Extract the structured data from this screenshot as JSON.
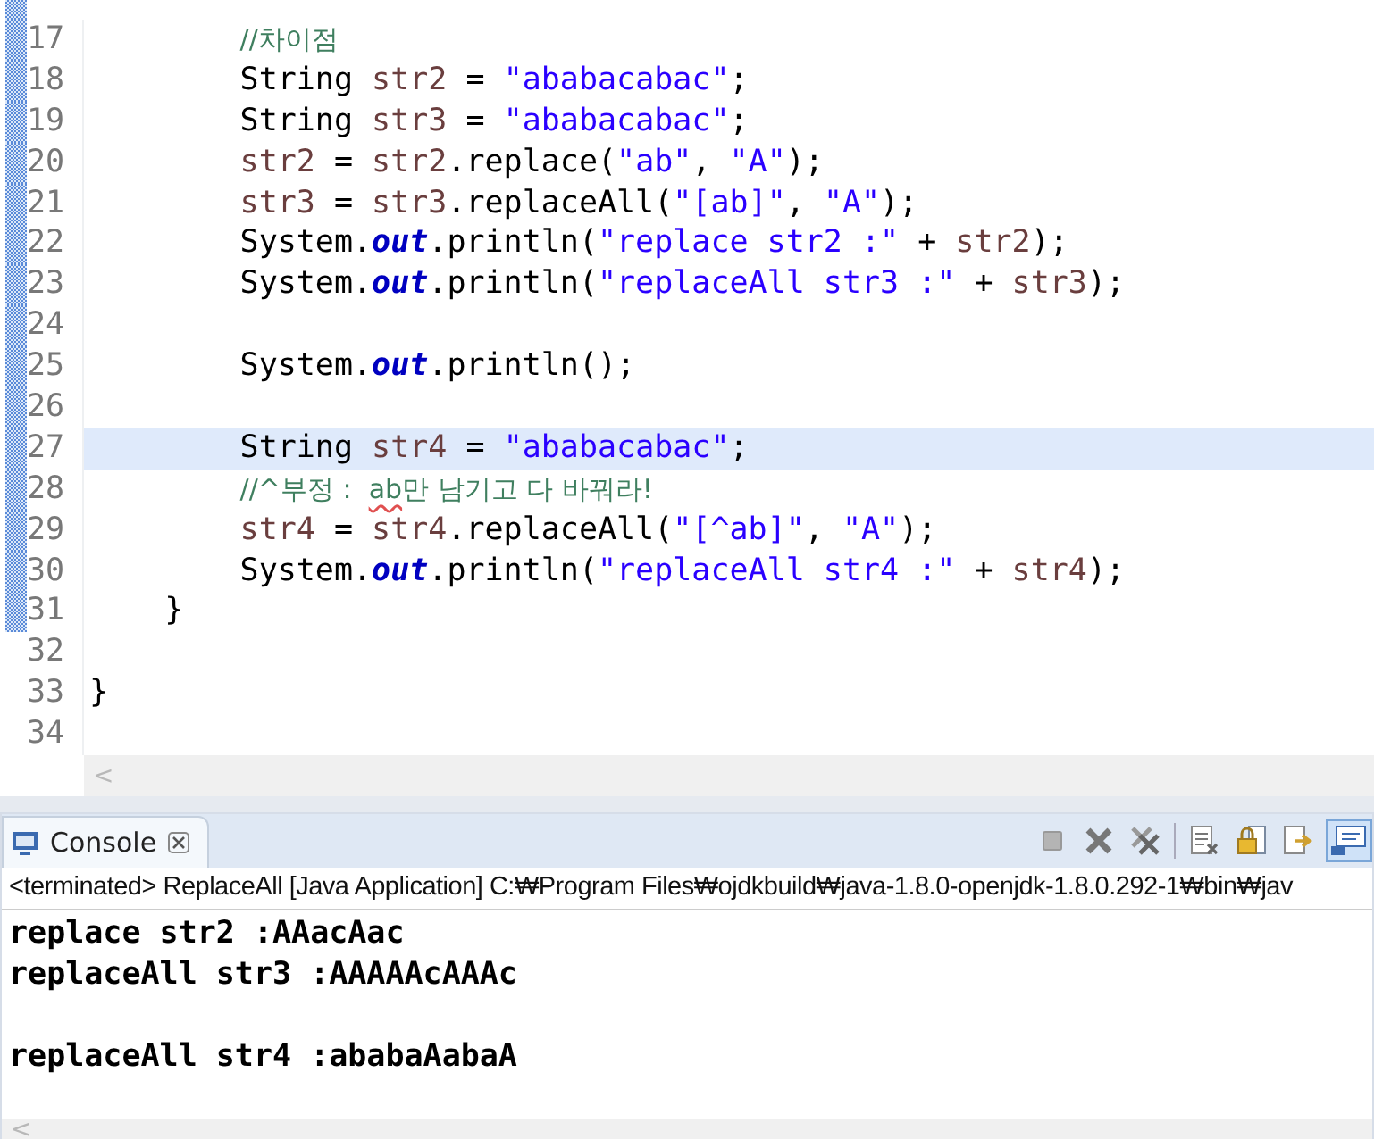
{
  "editor": {
    "lines": [
      {
        "number": "17",
        "changed": true,
        "highlighted": false,
        "kind": "body",
        "tokens": [
          {
            "kind": "comment",
            "t": "//차이점"
          }
        ]
      },
      {
        "number": "18",
        "changed": true,
        "highlighted": false,
        "kind": "body",
        "tokens": [
          {
            "kind": "plain",
            "t": "String "
          },
          {
            "kind": "var",
            "t": "str2"
          },
          {
            "kind": "plain",
            "t": " = "
          },
          {
            "kind": "str",
            "t": "\"ababacabac\""
          },
          {
            "kind": "plain",
            "t": ";"
          }
        ]
      },
      {
        "number": "19",
        "changed": true,
        "highlighted": false,
        "kind": "body",
        "tokens": [
          {
            "kind": "plain",
            "t": "String "
          },
          {
            "kind": "var",
            "t": "str3"
          },
          {
            "kind": "plain",
            "t": " = "
          },
          {
            "kind": "str",
            "t": "\"ababacabac\""
          },
          {
            "kind": "plain",
            "t": ";"
          }
        ]
      },
      {
        "number": "20",
        "changed": true,
        "highlighted": false,
        "kind": "body",
        "tokens": [
          {
            "kind": "var",
            "t": "str2"
          },
          {
            "kind": "plain",
            "t": " = "
          },
          {
            "kind": "var",
            "t": "str2"
          },
          {
            "kind": "plain",
            "t": ".replace("
          },
          {
            "kind": "str",
            "t": "\"ab\""
          },
          {
            "kind": "plain",
            "t": ", "
          },
          {
            "kind": "str",
            "t": "\"A\""
          },
          {
            "kind": "plain",
            "t": ");"
          }
        ]
      },
      {
        "number": "21",
        "changed": true,
        "highlighted": false,
        "kind": "body",
        "tokens": [
          {
            "kind": "var",
            "t": "str3"
          },
          {
            "kind": "plain",
            "t": " = "
          },
          {
            "kind": "var",
            "t": "str3"
          },
          {
            "kind": "plain",
            "t": ".replaceAll("
          },
          {
            "kind": "str",
            "t": "\"[ab]\""
          },
          {
            "kind": "plain",
            "t": ", "
          },
          {
            "kind": "str",
            "t": "\"A\""
          },
          {
            "kind": "plain",
            "t": ");"
          }
        ]
      },
      {
        "number": "22",
        "changed": true,
        "highlighted": false,
        "kind": "body",
        "tokens": [
          {
            "kind": "plain",
            "t": "System."
          },
          {
            "kind": "field",
            "t": "out"
          },
          {
            "kind": "plain",
            "t": ".println("
          },
          {
            "kind": "str",
            "t": "\"replace str2 :\""
          },
          {
            "kind": "plain",
            "t": " + "
          },
          {
            "kind": "var",
            "t": "str2"
          },
          {
            "kind": "plain",
            "t": ");"
          }
        ]
      },
      {
        "number": "23",
        "changed": true,
        "highlighted": false,
        "kind": "body",
        "tokens": [
          {
            "kind": "plain",
            "t": "System."
          },
          {
            "kind": "field",
            "t": "out"
          },
          {
            "kind": "plain",
            "t": ".println("
          },
          {
            "kind": "str",
            "t": "\"replaceAll str3 :\""
          },
          {
            "kind": "plain",
            "t": " + "
          },
          {
            "kind": "var",
            "t": "str3"
          },
          {
            "kind": "plain",
            "t": ");"
          }
        ]
      },
      {
        "number": "24",
        "changed": true,
        "highlighted": false
      },
      {
        "number": "25",
        "changed": true,
        "highlighted": false,
        "kind": "body",
        "tokens": [
          {
            "kind": "plain",
            "t": "System."
          },
          {
            "kind": "field",
            "t": "out"
          },
          {
            "kind": "plain",
            "t": ".println();"
          }
        ]
      },
      {
        "number": "26",
        "changed": true,
        "highlighted": false
      },
      {
        "number": "27",
        "changed": true,
        "highlighted": true,
        "kind": "body",
        "tokens": [
          {
            "kind": "plain",
            "t": "String "
          },
          {
            "kind": "var",
            "t": "str4"
          },
          {
            "kind": "plain",
            "t": " = "
          },
          {
            "kind": "str",
            "t": "\"ababacabac\""
          },
          {
            "kind": "plain",
            "t": ";"
          }
        ]
      },
      {
        "number": "28",
        "changed": true,
        "highlighted": false,
        "kind": "body",
        "tokens": [
          {
            "kind": "comment",
            "t": "//^부정 :  "
          },
          {
            "kind": "spell",
            "t": "ab"
          },
          {
            "kind": "comment",
            "t": "만 남기고 다 바꿔라!"
          }
        ]
      },
      {
        "number": "29",
        "changed": true,
        "highlighted": false,
        "kind": "body",
        "tokens": [
          {
            "kind": "var",
            "t": "str4"
          },
          {
            "kind": "plain",
            "t": " = "
          },
          {
            "kind": "var",
            "t": "str4"
          },
          {
            "kind": "plain",
            "t": ".replaceAll("
          },
          {
            "kind": "str",
            "t": "\"[^ab]\""
          },
          {
            "kind": "plain",
            "t": ", "
          },
          {
            "kind": "str",
            "t": "\"A\""
          },
          {
            "kind": "plain",
            "t": ");"
          }
        ]
      },
      {
        "number": "30",
        "changed": true,
        "highlighted": false,
        "kind": "body",
        "tokens": [
          {
            "kind": "plain",
            "t": "System."
          },
          {
            "kind": "field",
            "t": "out"
          },
          {
            "kind": "plain",
            "t": ".println("
          },
          {
            "kind": "str",
            "t": "\"replaceAll str4 :\""
          },
          {
            "kind": "plain",
            "t": " + "
          },
          {
            "kind": "var",
            "t": "str4"
          },
          {
            "kind": "plain",
            "t": ");"
          }
        ]
      },
      {
        "number": "31",
        "changed": true,
        "highlighted": false,
        "kind": "method",
        "tokens": [
          {
            "kind": "plain",
            "t": "}"
          }
        ]
      },
      {
        "number": "32",
        "changed": false,
        "highlighted": false
      },
      {
        "number": "33",
        "changed": false,
        "highlighted": false,
        "kind": "class",
        "tokens": [
          {
            "kind": "plain",
            "t": "}"
          }
        ]
      },
      {
        "number": "34",
        "changed": false,
        "highlighted": false
      }
    ],
    "scroll_left": "<"
  },
  "console": {
    "tab": {
      "label": "Console",
      "selected": true
    },
    "info": "<terminated> ReplaceAll [Java Application] C:₩Program Files₩ojdkbuild₩java-1.8.0-openjdk-1.8.0.292-1₩bin₩jav",
    "output_blocks": [
      [
        "replace str2 :AAacAac",
        "replaceAll str3 :AAAAAcAAAc"
      ],
      [
        "replaceAll str4 :ababaAabaA"
      ]
    ],
    "scroll_left": "<"
  }
}
